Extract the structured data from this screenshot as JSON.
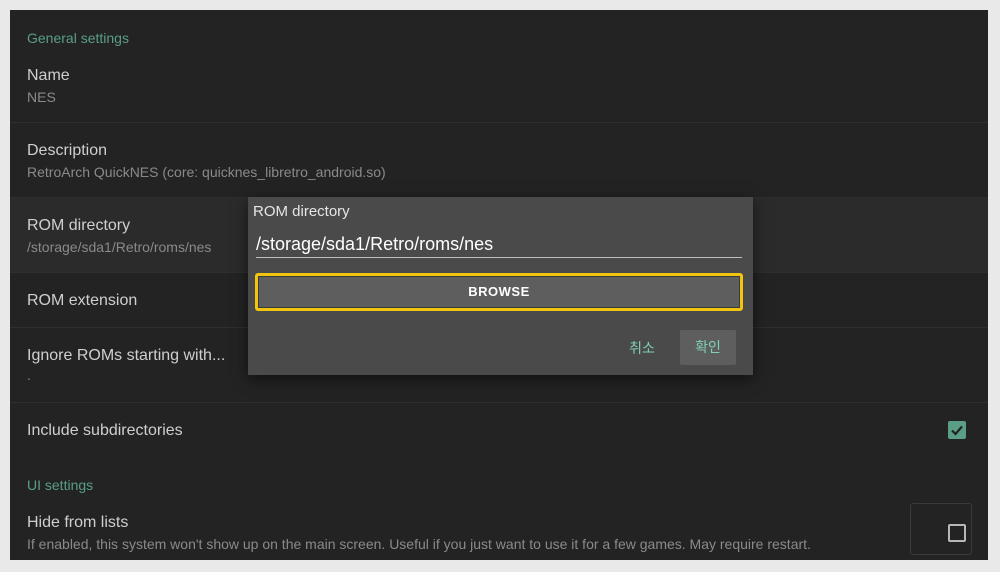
{
  "sections": {
    "general": "General settings",
    "ui": "UI settings"
  },
  "rows": {
    "name": {
      "title": "Name",
      "value": "NES"
    },
    "description": {
      "title": "Description",
      "value": "RetroArch QuickNES (core: quicknes_libretro_android.so)"
    },
    "rom_directory": {
      "title": "ROM directory",
      "value": "/storage/sda1/Retro/roms/nes"
    },
    "rom_extension": {
      "title": "ROM extension"
    },
    "ignore_roms": {
      "title": "Ignore ROMs starting with...",
      "value": "."
    },
    "include_subdirs": {
      "title": "Include subdirectories",
      "checked": true
    },
    "hide_from_lists": {
      "title": "Hide from lists",
      "value": "If enabled, this system won't show up on the main screen. Useful if you just want to use it for a few games. May require restart.",
      "checked": false
    }
  },
  "dialog": {
    "title": "ROM directory",
    "input_value": "/storage/sda1/Retro/roms/nes",
    "browse_label": "BROWSE",
    "cancel_label": "취소",
    "ok_label": "확인"
  },
  "colors": {
    "accent": "#5a9e86",
    "focus_border": "#f1c40f",
    "background": "#232323",
    "dialog_bg": "#4a4a4a"
  }
}
